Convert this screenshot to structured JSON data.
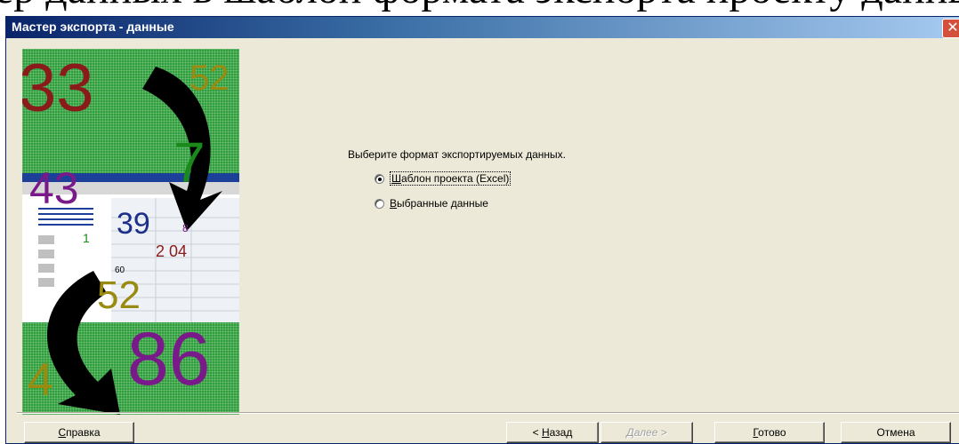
{
  "background_text": "ер  данных  в  шаблон  формата  экспорта  проекту  данных  (ф",
  "window": {
    "title": "Мастер экспорта - данные",
    "close_label": "✕"
  },
  "art": {
    "numbers": [
      "33",
      "52",
      "7",
      "43",
      "39",
      "8",
      "1",
      "2 04",
      "60",
      "52",
      "86",
      "4"
    ]
  },
  "main": {
    "prompt": "Выберите формат экспортируемых данных.",
    "options": [
      {
        "label_pre": "",
        "label_u": "Ш",
        "label_post": "аблон проекта (Excel)",
        "selected": true
      },
      {
        "label_pre": "",
        "label_u": "В",
        "label_post": "ыбранные данные",
        "selected": false
      }
    ]
  },
  "buttons": {
    "help": {
      "u": "С",
      "rest": "правка"
    },
    "back": {
      "pre": "< ",
      "u": "Н",
      "rest": "азад"
    },
    "next": {
      "label": "Далее >",
      "enabled": false
    },
    "finish": {
      "u": "Г",
      "rest": "отово"
    },
    "cancel": "Отмена"
  }
}
